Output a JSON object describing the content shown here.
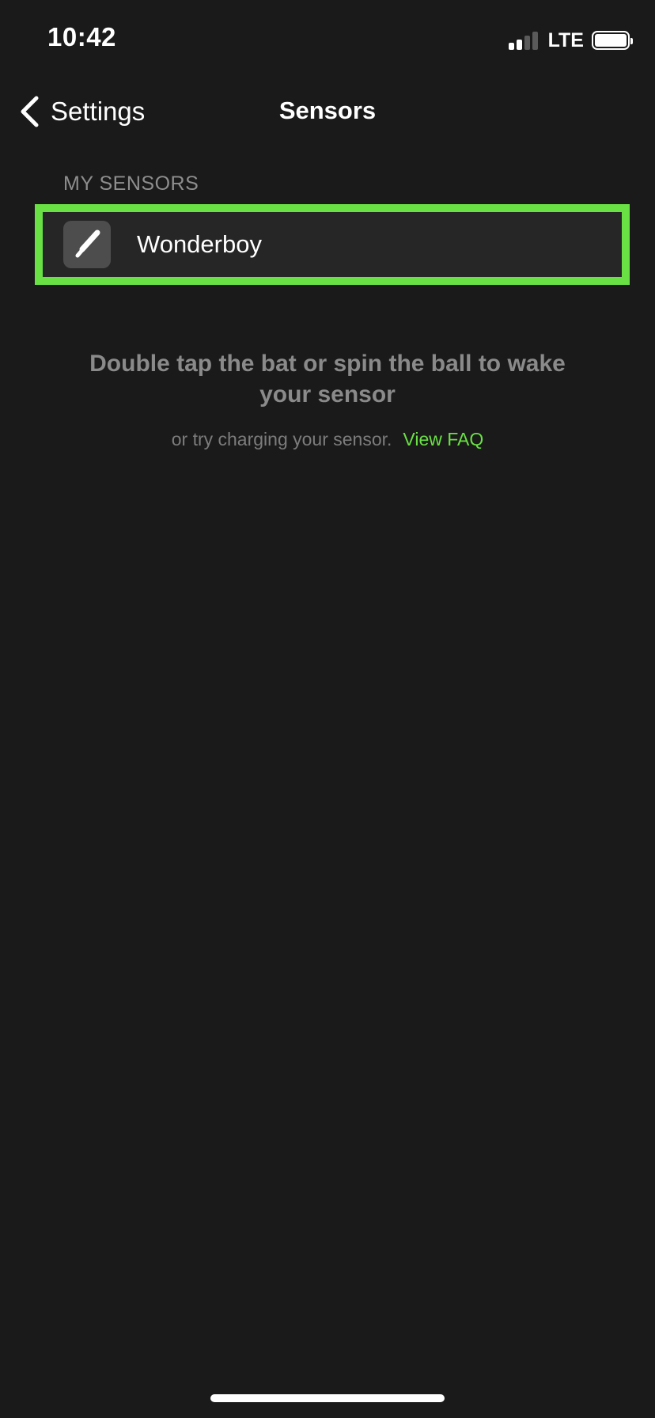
{
  "status_bar": {
    "time": "10:42",
    "network": "LTE",
    "signal_bars_active": 2,
    "signal_bars_total": 4,
    "battery_icon": "battery-full-icon"
  },
  "nav": {
    "back_icon": "chevron-left-icon",
    "back_label": "Settings",
    "title": "Sensors"
  },
  "sensors": {
    "section_header": "MY SENSORS",
    "items": [
      {
        "name": "Wonderboy",
        "icon": "baseball-bat-icon"
      }
    ]
  },
  "help": {
    "title": "Double tap the bat or spin the ball to wake your sensor",
    "subtitle": "or try charging your sensor.",
    "faq_link": "View FAQ"
  },
  "colors": {
    "background": "#1a1a1a",
    "accent": "#69e144",
    "row_background": "#262626",
    "secondary_text": "#8a8a8a"
  }
}
